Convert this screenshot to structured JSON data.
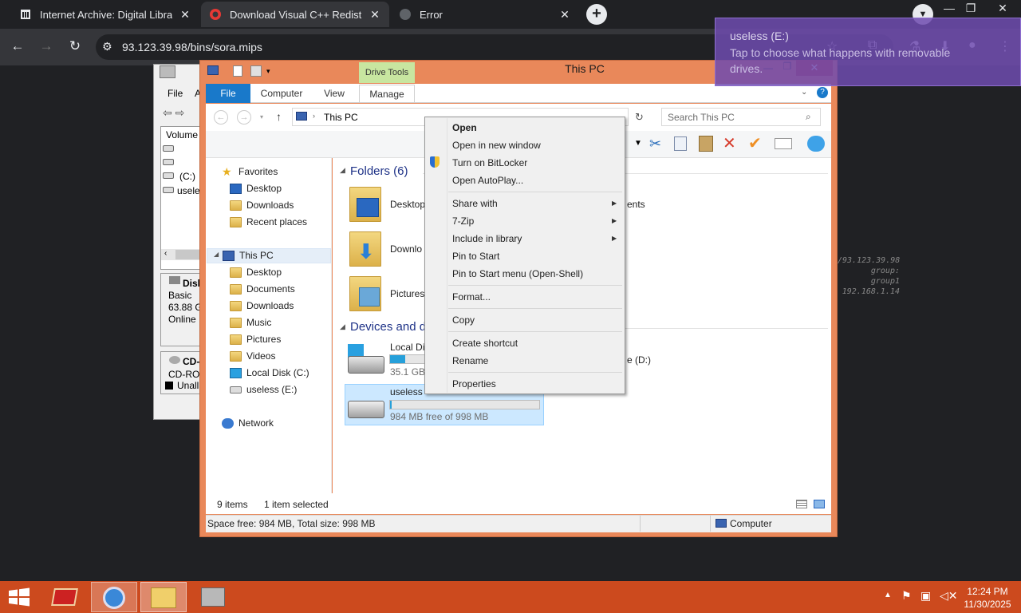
{
  "browser": {
    "tabs": [
      {
        "label": "Internet Archive: Digital Library"
      },
      {
        "label": "Download Visual C++ Redistributable"
      },
      {
        "label": "Error"
      }
    ],
    "url": "93.123.39.98/bins/sora.mips"
  },
  "notification": {
    "title": "useless  (E:)",
    "body": "Tap to choose what happens with removable drives."
  },
  "old_explorer": {
    "menu": [
      "File",
      "A"
    ],
    "col_header": "Volume",
    "drives": [
      "",
      "",
      "(C:)",
      "usele"
    ],
    "disk_label": "Disk",
    "disk_type": "Basic",
    "disk_size": "63.88 G",
    "disk_status": "Online",
    "cd_label": "CD-",
    "cd_type": "CD-RO",
    "cd_status": "Unall"
  },
  "explorer": {
    "title": "This PC",
    "drive_tools": "Drive Tools",
    "tabs": {
      "file": "File",
      "computer": "Computer",
      "view": "View",
      "manage": "Manage"
    },
    "address": "This PC",
    "search_placeholder": "Search This PC",
    "nav": {
      "favorites": "Favorites",
      "fav_items": [
        "Desktop",
        "Downloads",
        "Recent places"
      ],
      "this_pc": "This PC",
      "pc_items": [
        "Desktop",
        "Documents",
        "Downloads",
        "Music",
        "Pictures",
        "Videos",
        "Local Disk (C:)",
        "useless  (E:)"
      ],
      "network": "Network"
    },
    "folders_header": "Folders (6)",
    "folders": [
      "Desktop",
      "Downlo",
      "Pictures"
    ],
    "folders_right": [
      "ents"
    ],
    "devices_header": "Devices and d",
    "devices": [
      {
        "name": "Local Di",
        "free": "35.1 GB",
        "fill": 0.45
      },
      {
        "name": "useless",
        "free": "984 MB free of 998 MB",
        "fill": 0.01
      }
    ],
    "device_right": "e (D:)",
    "status_items": "9 items",
    "status_selected": "1 item selected",
    "bottom_space": "Space free: 984 MB, Total size: 998 MB",
    "bottom_computer": "Computer"
  },
  "context_menu": {
    "items": [
      "Open",
      "Open in new window",
      "Turn on BitLocker",
      "Open AutoPlay...",
      "Share with",
      "7-Zip",
      "Include in library",
      "Pin to Start",
      "Pin to Start menu (Open-Shell)",
      "Format...",
      "Copy",
      "Create shortcut",
      "Rename",
      "Properties"
    ]
  },
  "terminal": [
    "/93.123.39.98",
    "group: group1",
    "192.168.1.14"
  ],
  "taskbar": {
    "time": "12:24 PM",
    "date": "11/30/2025"
  },
  "colors": {
    "accent": "#1979ca",
    "window_frame": "#e9885a",
    "taskbar": "#cc4a1e",
    "notification": "#6e4baf"
  }
}
